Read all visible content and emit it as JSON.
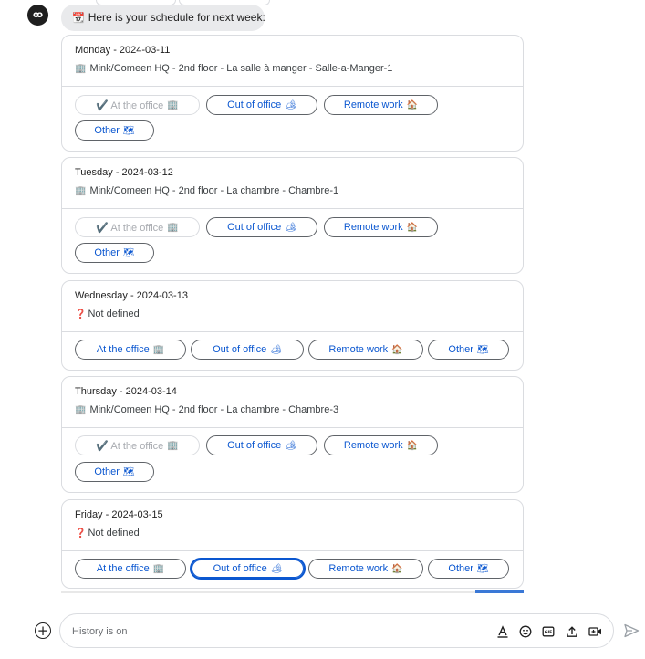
{
  "message": {
    "emoji": "📆",
    "text": "Here is your schedule for next week:"
  },
  "buttons": {
    "at_office": "At the office",
    "at_office_checked": "✔️ At the office",
    "office_emoji": "🏢",
    "out_of_office": "Out of office",
    "out_emoji": "🏕",
    "remote": "Remote work",
    "remote_emoji": "🏠",
    "other": "Other",
    "other_emoji": "🗺"
  },
  "days": [
    {
      "title": "Monday - 2024-03-11",
      "location": "Mink/Comeen HQ - 2nd floor - La salle à manger - Salle-a-Manger-1",
      "icon": "🏢"
    },
    {
      "title": "Tuesday - 2024-03-12",
      "location": "Mink/Comeen HQ - 2nd floor - La chambre - Chambre-1",
      "icon": "🏢"
    },
    {
      "title": "Wednesday - 2024-03-13",
      "location": "Not defined",
      "icon": "❓"
    },
    {
      "title": "Thursday - 2024-03-14",
      "location": "Mink/Comeen HQ - 2nd floor - La chambre - Chambre-3",
      "icon": "🏢"
    },
    {
      "title": "Friday - 2024-03-15",
      "location": "Not defined",
      "icon": "❓"
    }
  ],
  "composer": {
    "placeholder": "History is on"
  },
  "colors": {
    "accent": "#0b57d0",
    "border": "#dadce0",
    "bubble": "#e9eaec"
  }
}
